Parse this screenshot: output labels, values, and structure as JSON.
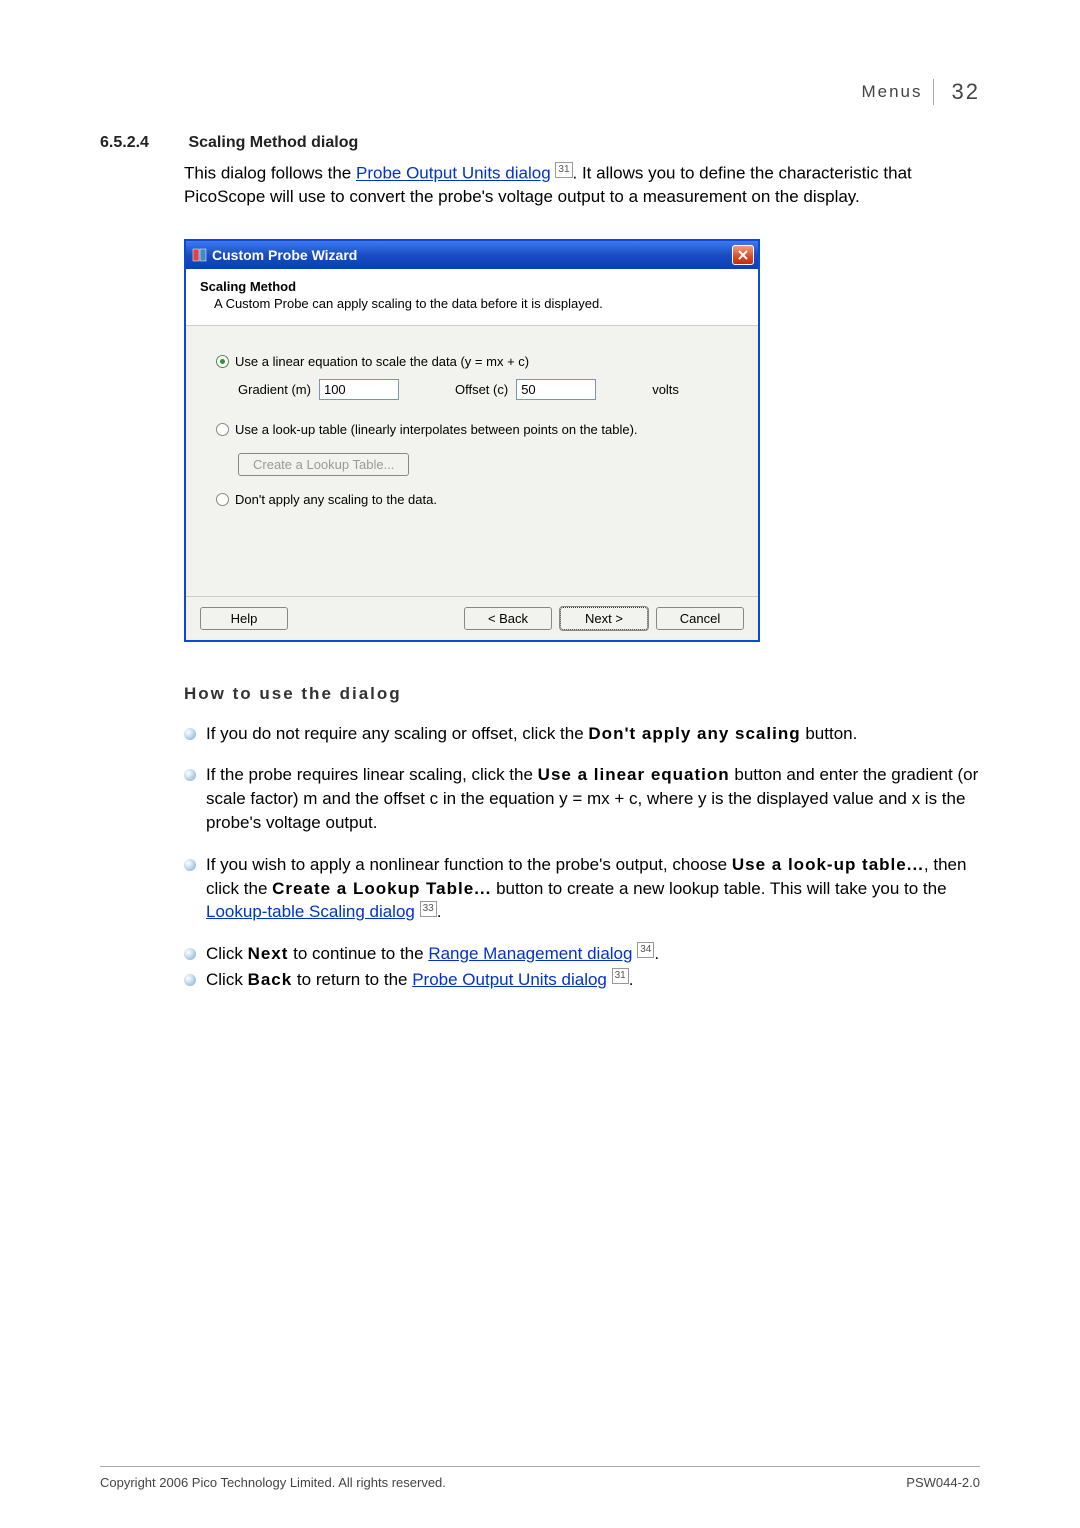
{
  "header": {
    "label": "Menus",
    "page_number": "32"
  },
  "section": {
    "number": "6.5.2.4",
    "title": "Scaling Method dialog"
  },
  "intro": {
    "pre_link": "This dialog follows the ",
    "link": "Probe Output Units dialog",
    "ref": "31",
    "post_link": ". It allows you to define the characteristic that PicoScope will use to convert the probe's voltage output to a measurement on the display."
  },
  "dialog": {
    "title": "Custom Probe Wizard",
    "header_title": "Scaling Method",
    "header_sub": "A Custom Probe can apply scaling to the data before it is displayed.",
    "opt_linear": "Use a linear equation to scale the data (y = mx + c)",
    "gradient_label": "Gradient (m)",
    "gradient_value": "100",
    "offset_label": "Offset (c)",
    "offset_value": "50",
    "offset_unit": "volts",
    "opt_lookup": "Use a look-up table (linearly interpolates between points on the table).",
    "lookup_btn": "Create a Lookup Table...",
    "opt_none": "Don't apply any scaling to the data.",
    "help": "Help",
    "back": "< Back",
    "next": "Next >",
    "cancel": "Cancel"
  },
  "howto": {
    "title": "How to use the dialog",
    "b1a": "If you do not require any scaling or offset, click the ",
    "b1b": "Don't apply any scaling",
    "b1c": " button.",
    "b2a": "If the probe requires linear scaling, click the ",
    "b2b": "Use a linear equation",
    "b2c": " button and enter the gradient (or scale factor) m and the offset c in the equation y = mx + c, where y is the displayed value and x is the probe's voltage output.",
    "b3a": "If you wish to apply a nonlinear function to the probe's output, choose ",
    "b3b": "Use a look-up table...",
    "b3c": ", then click the ",
    "b3d": "Create a Lookup Table...",
    "b3e": " button to create a new lookup table. This will take you to the ",
    "b3link": "Lookup-table Scaling dialog",
    "b3ref": "33",
    "b3f": ".",
    "b4a": "Click ",
    "b4b": "Next",
    "b4c": " to continue to the ",
    "b4link": "Range Management dialog",
    "b4ref": "34",
    "b4d": ".",
    "b5a": "Click ",
    "b5b": "Back",
    "b5c": " to return to the ",
    "b5link": "Probe Output Units dialog",
    "b5ref": "31",
    "b5d": "."
  },
  "footer": {
    "copyright": "Copyright 2006 Pico Technology Limited. All rights reserved.",
    "docid": "PSW044-2.0"
  }
}
